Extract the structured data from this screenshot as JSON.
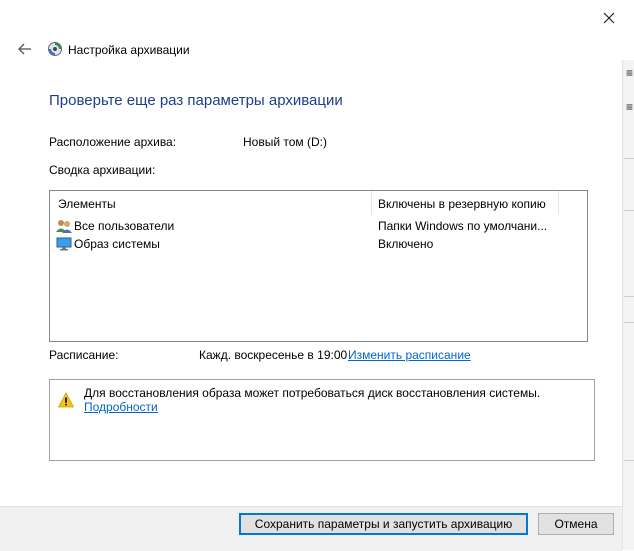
{
  "window": {
    "title": "Настройка архивации"
  },
  "heading": "Проверьте еще раз параметры архивации",
  "location": {
    "label": "Расположение архива:",
    "value": "Новый том (D:)"
  },
  "summary": {
    "label": "Сводка архивации:",
    "columns": [
      "Элементы",
      "Включены в резервную копию"
    ],
    "rows": [
      {
        "icon": "users-icon",
        "name": "Все пользователи",
        "included": "Папки Windows по умолчани..."
      },
      {
        "icon": "monitor-icon",
        "name": "Образ системы",
        "included": "Включено"
      }
    ]
  },
  "schedule": {
    "label": "Расписание:",
    "value": "Кажд. воскресенье в 19:00",
    "change_link": "Изменить расписание"
  },
  "warning": {
    "icon": "warning-icon",
    "text": "Для восстановления образа может потребоваться диск восстановления системы.",
    "details_link": "Подробности"
  },
  "buttons": {
    "save": "Сохранить параметры и запустить архивацию",
    "cancel": "Отмена"
  },
  "background_window": {
    "marks": [
      "≡",
      "≡"
    ]
  },
  "colors": {
    "heading": "#1f3f88",
    "link": "#0066cc",
    "primary_border": "#0078d7",
    "warning": "#f5c518"
  }
}
